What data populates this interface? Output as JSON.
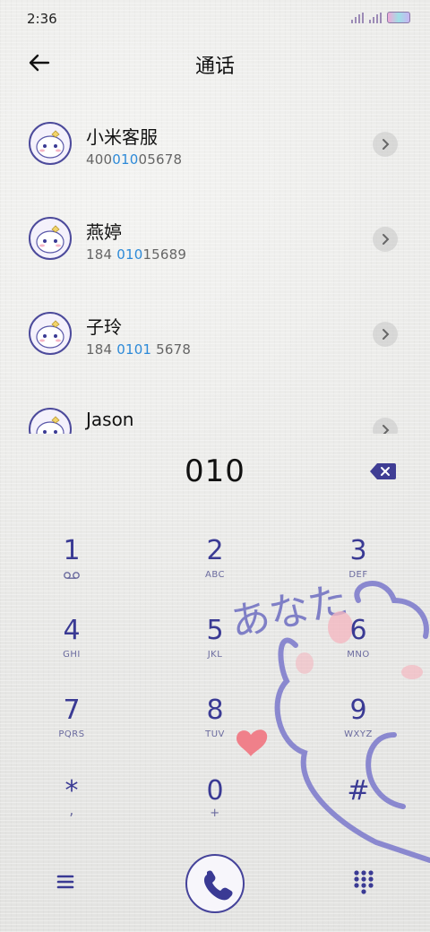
{
  "status": {
    "time": "2:36"
  },
  "header": {
    "title": "通话"
  },
  "contacts": [
    {
      "name": "小米客服",
      "number_pre": "400",
      "number_hl": "010",
      "number_post": "05678"
    },
    {
      "name": "燕婷",
      "number_pre": "184 ",
      "number_hl": "010",
      "number_post": "15689"
    },
    {
      "name": "子玲",
      "number_pre": "184 ",
      "number_hl": "0101",
      "number_post": " 5678"
    },
    {
      "name": "Jason",
      "number_pre": "",
      "number_hl": "",
      "number_post": ""
    }
  ],
  "dial": {
    "number": "010"
  },
  "keys": [
    {
      "digit": "1",
      "sub": ""
    },
    {
      "digit": "2",
      "sub": "ABC"
    },
    {
      "digit": "3",
      "sub": "DEF"
    },
    {
      "digit": "4",
      "sub": "GHI"
    },
    {
      "digit": "5",
      "sub": "JKL"
    },
    {
      "digit": "6",
      "sub": "MNO"
    },
    {
      "digit": "7",
      "sub": "PQRS"
    },
    {
      "digit": "8",
      "sub": "TUV"
    },
    {
      "digit": "9",
      "sub": "WXYZ"
    },
    {
      "digit": "*",
      "sub": ","
    },
    {
      "digit": "0",
      "sub": "+"
    },
    {
      "digit": "#",
      "sub": ""
    }
  ],
  "decoration": {
    "text": "あなた"
  },
  "colors": {
    "accent": "#3a3a94",
    "highlight": "#2d8ad8"
  }
}
